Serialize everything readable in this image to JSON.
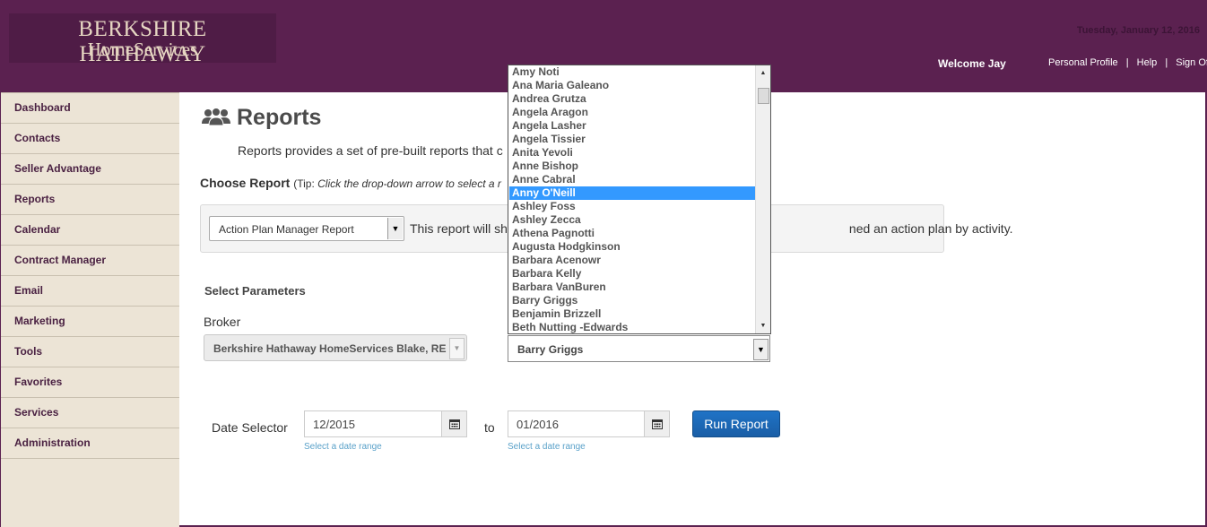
{
  "header": {
    "logo_line1": "BERKSHIRE HATHAWAY",
    "logo_line2": "HomeServices",
    "date": "Tuesday, January 12, 2016",
    "welcome": "Welcome Jay",
    "links": [
      "Personal Profile",
      "Help",
      "Sign Off"
    ],
    "link_separator": "|"
  },
  "sidebar": {
    "items": [
      "Dashboard",
      "Contacts",
      "Seller Advantage",
      "Reports",
      "Calendar",
      "Contract Manager",
      "Email",
      "Marketing",
      "Tools",
      "Favorites",
      "Services",
      "Administration"
    ]
  },
  "main": {
    "title": "Reports",
    "intro": "Reports provides a set of pre-built reports that c",
    "choose_label": "Choose Report",
    "choose_tip_prefix": "(Tip: ",
    "choose_tip_italic": "Click the drop-down arrow to select a r",
    "report_select_value": "Action Plan Manager Report",
    "report_desc_left": "This report will sh",
    "report_desc_right": "ned an action plan by activity.",
    "select_parameters": "Select Parameters",
    "broker_label": "Broker",
    "broker_value": "Berkshire Hathaway HomeServices Blake, REALTORS",
    "agent_value": "Barry Griggs",
    "date_selector_label": "Date Selector",
    "from_date": "12/2015",
    "to_label": "to",
    "to_date": "01/2016",
    "date_hint": "Select a date range",
    "run_button": "Run Report"
  },
  "dropdown": {
    "items": [
      "Amy Noti",
      "Ana Maria Galeano",
      "Andrea Grutza",
      "Angela Aragon",
      "Angela Lasher",
      "Angela Tissier",
      "Anita Yevoli",
      "Anne Bishop",
      "Anne Cabral",
      "Anny O'Neill",
      "Ashley Foss",
      "Ashley Zecca",
      "Athena Pagnotti",
      "Augusta Hodgkinson",
      "Barbara Acenowr",
      "Barbara Kelly",
      "Barbara VanBuren",
      "Barry Griggs",
      "Benjamin Brizzell",
      "Beth Nutting -Edwards"
    ],
    "highlighted": "Anny O'Neill"
  },
  "colors": {
    "brand_purple": "#5b2150",
    "sidebar_bg": "#ece4d6",
    "highlight": "#3399ff",
    "button_blue": "#1a66b8"
  }
}
